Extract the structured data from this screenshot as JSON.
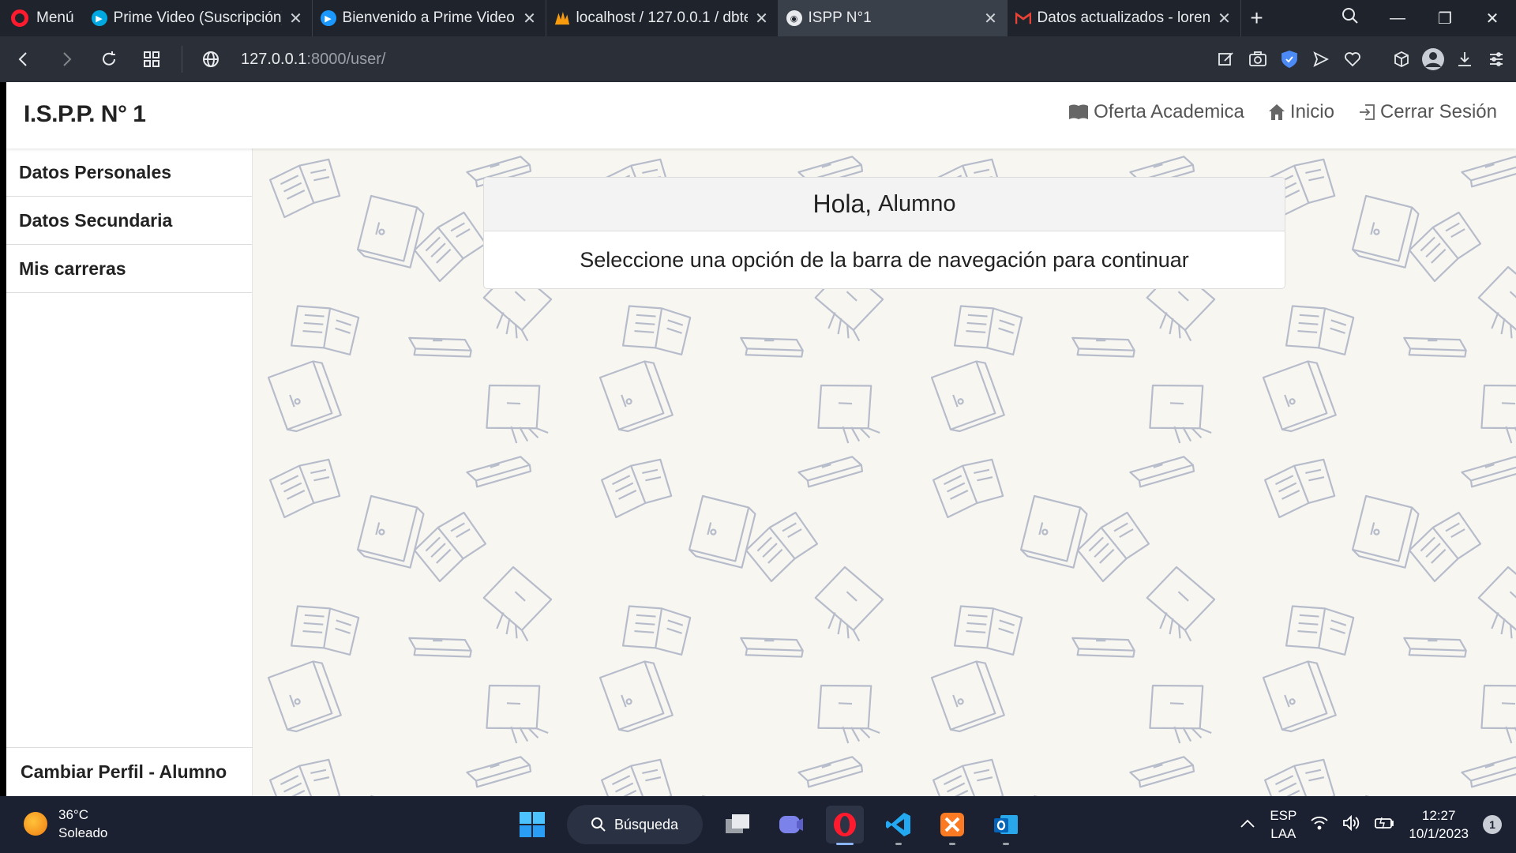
{
  "browser": {
    "menu_label": "Menú",
    "tabs": [
      {
        "title": "Prime Video (Suscripción) -",
        "favicon": "prime-video-icon",
        "color": "#00a8e1"
      },
      {
        "title": "Bienvenido a Prime Video",
        "favicon": "prime-video-icon",
        "color": "#1a98ff"
      },
      {
        "title": "localhost / 127.0.0.1 / dbte",
        "favicon": "phpmyadmin-icon",
        "color": "#f89c0e"
      },
      {
        "title": "ISPP N°1",
        "favicon": "site-icon",
        "color": "#8ab4f8"
      },
      {
        "title": "Datos actualizados - lorena",
        "favicon": "gmail-icon",
        "color": "#ea4335"
      }
    ],
    "active_tab_index": 3,
    "url_host": "127.0.0.1",
    "url_path": ":8000/user/"
  },
  "app": {
    "brand": "I.S.P.P. N° 1",
    "nav": [
      {
        "label": "Oferta Academica",
        "icon": "book-icon"
      },
      {
        "label": "Inicio",
        "icon": "home-icon"
      },
      {
        "label": "Cerrar Sesión",
        "icon": "logout-icon"
      }
    ],
    "sidebar": {
      "items": [
        {
          "label": "Datos Personales"
        },
        {
          "label": "Datos Secundaria"
        },
        {
          "label": "Mis carreras"
        }
      ],
      "footer": "Cambiar Perfil - Alumno"
    },
    "card": {
      "greeting": "Hola,",
      "name": "Alumno",
      "message": "Seleccione una opción de la barra de navegación para continuar"
    }
  },
  "taskbar": {
    "weather_temp": "36°C",
    "weather_desc": "Soleado",
    "search_label": "Búsqueda",
    "lang_1": "ESP",
    "lang_2": "LAA",
    "time": "12:27",
    "date": "10/1/2023",
    "notifications": "1"
  }
}
